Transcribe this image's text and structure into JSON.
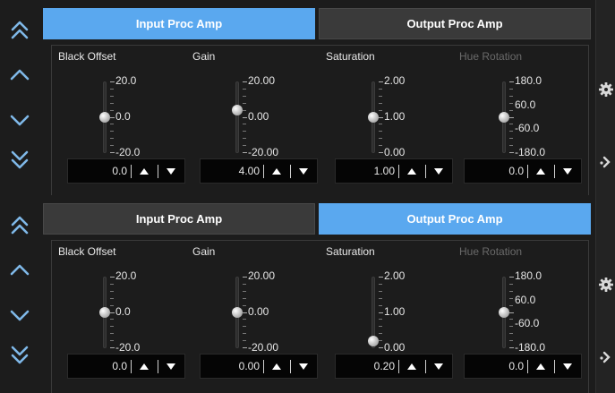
{
  "colors": {
    "active_tab": "#5aa8ef",
    "inactive_tab": "#3a3a3a",
    "background": "#1c1c1c",
    "nav_arrow": "#7fb8e8"
  },
  "nav_icons": [
    "double-chevron-up-icon",
    "chevron-up-icon",
    "chevron-down-icon",
    "double-chevron-down-icon"
  ],
  "right_icons": [
    "gear-icon",
    "chevron-right-icon"
  ],
  "panels": [
    {
      "tabs": [
        {
          "label": "Input Proc Amp",
          "active": true
        },
        {
          "label": "Output Proc Amp",
          "active": false
        }
      ],
      "controls": [
        {
          "label": "Black Offset",
          "enabled": true,
          "scale": [
            "20.0",
            "0.0",
            "-20.0"
          ],
          "value": "0.0",
          "level": 0.5
        },
        {
          "label": "Gain",
          "enabled": true,
          "scale": [
            "20.00",
            "0.00",
            "-20.00"
          ],
          "value": "4.00",
          "level": 0.6
        },
        {
          "label": "Saturation",
          "enabled": true,
          "scale": [
            "2.00",
            "1.00",
            "0.00"
          ],
          "value": "1.00",
          "level": 0.5
        },
        {
          "label": "Hue Rotation",
          "enabled": false,
          "scale": [
            "180.0",
            "60.0",
            "-60.0",
            "-180.0"
          ],
          "value": "0.0",
          "level": 0.5
        }
      ]
    },
    {
      "tabs": [
        {
          "label": "Input Proc Amp",
          "active": false
        },
        {
          "label": "Output Proc Amp",
          "active": true
        }
      ],
      "controls": [
        {
          "label": "Black Offset",
          "enabled": true,
          "scale": [
            "20.0",
            "0.0",
            "-20.0"
          ],
          "value": "0.0",
          "level": 0.5
        },
        {
          "label": "Gain",
          "enabled": true,
          "scale": [
            "20.00",
            "0.00",
            "-20.00"
          ],
          "value": "0.00",
          "level": 0.5
        },
        {
          "label": "Saturation",
          "enabled": true,
          "scale": [
            "2.00",
            "1.00",
            "0.00"
          ],
          "value": "0.20",
          "level": 0.1
        },
        {
          "label": "Hue Rotation",
          "enabled": false,
          "scale": [
            "180.0",
            "60.0",
            "-60.0",
            "-180.0"
          ],
          "value": "0.0",
          "level": 0.5
        }
      ]
    }
  ]
}
